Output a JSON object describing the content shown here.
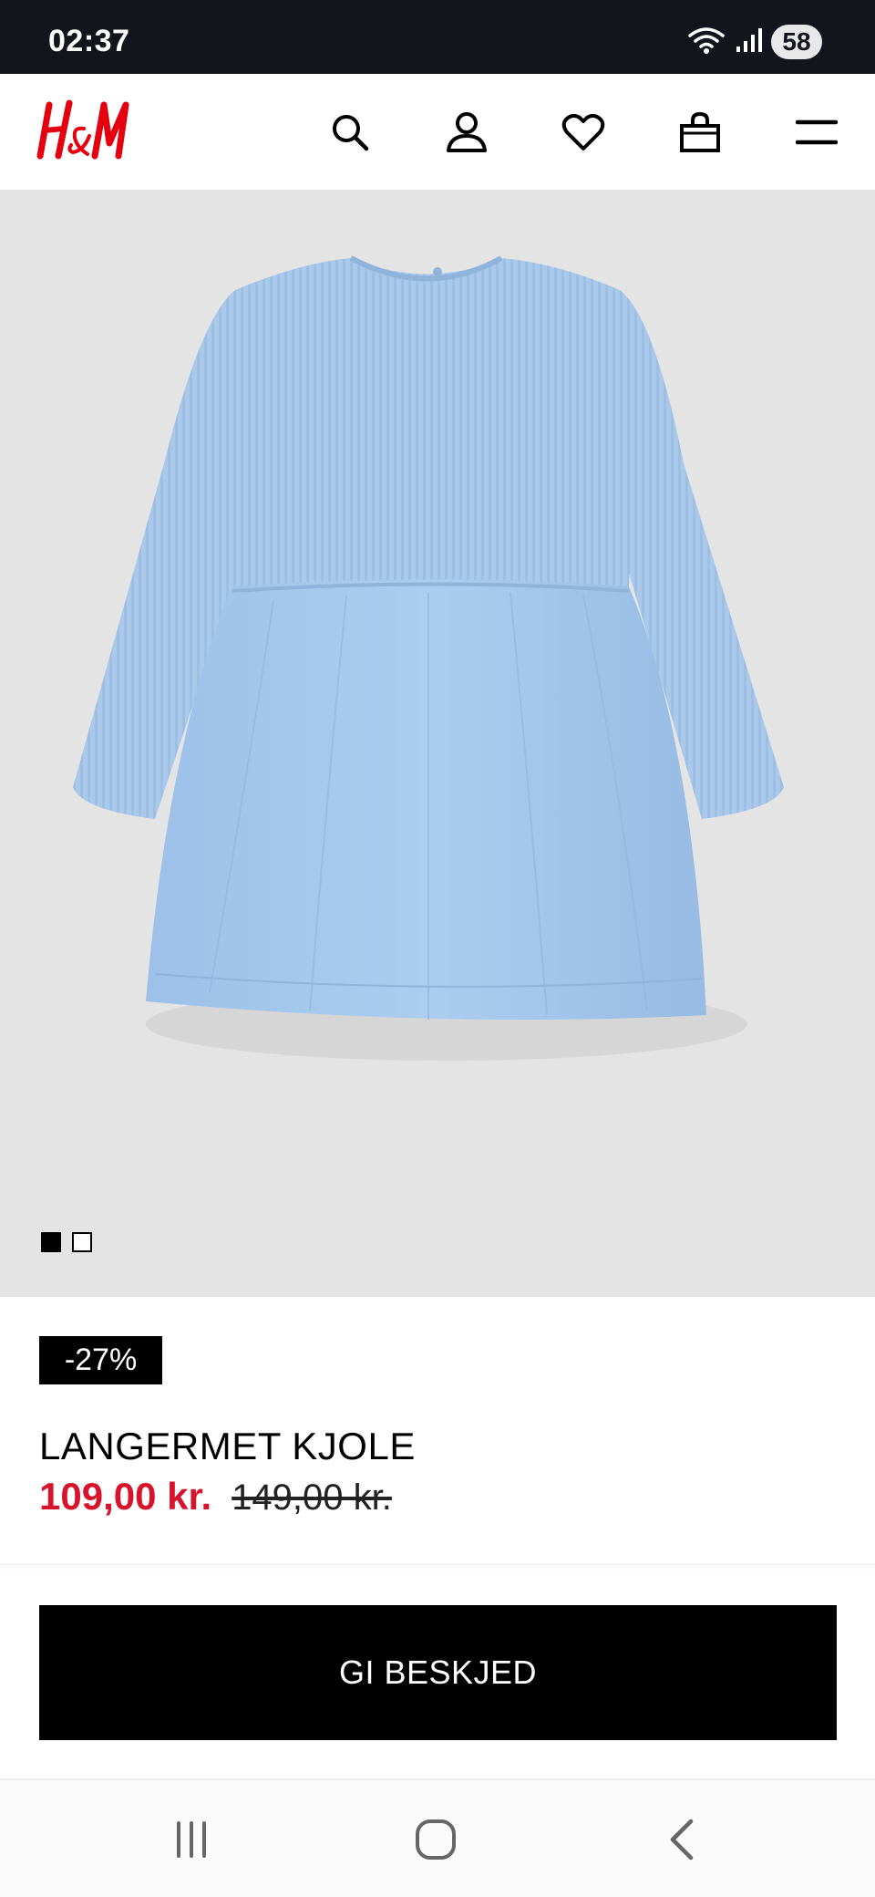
{
  "status_bar": {
    "time": "02:37",
    "battery": "58",
    "icons": [
      "wifi-icon",
      "signal-icon",
      "battery-icon"
    ]
  },
  "header": {
    "logo_text": "H&M",
    "icons": [
      "search-icon",
      "account-icon",
      "heart-icon",
      "bag-icon",
      "menu-icon"
    ]
  },
  "gallery": {
    "image": "light-blue-long-sleeve-dress-photo",
    "dots_count": 2,
    "active_index": 0
  },
  "product": {
    "discount": "-27%",
    "title": "LANGERMET KJOLE",
    "price_sale": "109,00 kr.",
    "price_original": "149,00 kr."
  },
  "actions": {
    "notify_label": "GI BESKJED"
  },
  "nav_bar": {
    "buttons": [
      "recent-apps-icon",
      "home-icon",
      "back-icon"
    ]
  },
  "colors": {
    "brand_red": "#e50010",
    "sale_red": "#d7142b",
    "status_bar_bg": "#14151c",
    "image_bg": "#e4e4e4"
  }
}
